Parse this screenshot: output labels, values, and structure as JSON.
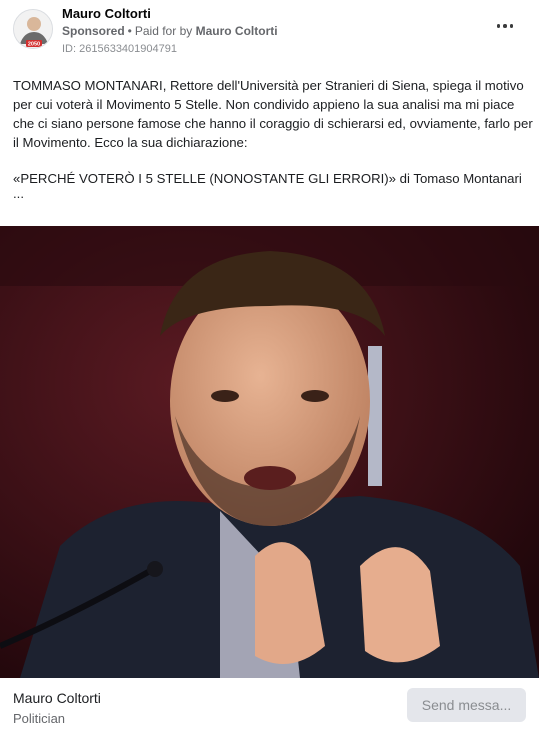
{
  "header": {
    "page_name": "Mauro Coltorti",
    "sponsored_label": "Sponsored",
    "separator": "•",
    "paid_for_prefix": "Paid for by",
    "paid_for_name": "Mauro Coltorti",
    "ad_id": "ID: 2615633401904791",
    "avatar_badge": "2050",
    "more_icon": "more-horizontal-icon"
  },
  "post": {
    "paragraph_1": "TOMMASO MONTANARI, Rettore dell'Università per Stranieri di Siena, spiega il motivo per cui voterà il Movimento 5 Stelle. Non condivido appieno la sua analisi ma mi piace che ci siano persone famose che hanno il coraggio di schierarsi ed, ovviamente, farlo per il Movimento. Ecco la sua dichiarazione:",
    "paragraph_2": "«PERCHÉ VOTERÒ I 5 STELLE (NONOSTANTE GLI ERRORI)» di Tomaso Montanari",
    "ellipsis": "..."
  },
  "footer": {
    "name": "Mauro Coltorti",
    "category": "Politician",
    "cta_label": "Send messa..."
  },
  "colors": {
    "page_background": "#ffffff",
    "secondary_text": "#65676b",
    "button_background": "#e4e6eb",
    "photo_background": "#3b0e16"
  }
}
